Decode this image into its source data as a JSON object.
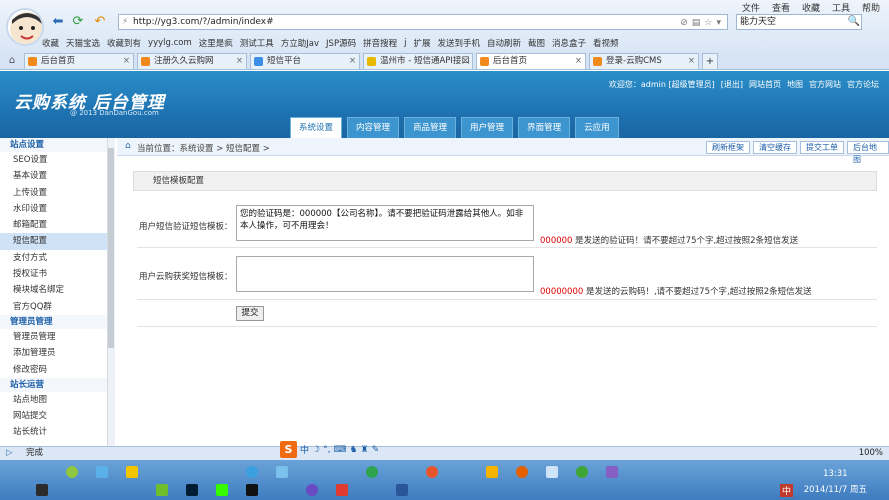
{
  "browser": {
    "menu": [
      "文件",
      "查看",
      "收藏",
      "工具",
      "帮助"
    ],
    "address": "http://yg3.com/?/admin/index#",
    "search_value": "能力天空",
    "bookmarks": [
      "收藏",
      "天猫宝选",
      "收藏到有",
      "yyylg.com",
      "这里是疯",
      "测试工具",
      "方立助Jav",
      "JSP源码",
      "拼音搜程",
      "j",
      "扩展",
      "发送到手机",
      "自动刷新",
      "截图",
      "消息盒子",
      "看视频"
    ],
    "tabs": [
      {
        "label": "后台首页",
        "active": false
      },
      {
        "label": "注册久久云购网",
        "active": false
      },
      {
        "label": "短信平台",
        "active": false
      },
      {
        "label": "温州市 - 短信通API接口",
        "active": false
      },
      {
        "label": "后台首页",
        "active": true
      },
      {
        "label": "登录-云购CMS",
        "active": false
      }
    ]
  },
  "header": {
    "logo": "云购系统 后台管理",
    "logo_sub": "@ 2013  DanDanGou.com",
    "welcome": "欢迎您：",
    "user": "admin",
    "role": "[超级管理员]",
    "logout": "[退出]",
    "site_home": "网站首页",
    "map": "地图",
    "official": "官方网站",
    "forum": "官方论坛"
  },
  "main_tabs": [
    {
      "label": "系统设置",
      "active": true
    },
    {
      "label": "内容管理",
      "active": false
    },
    {
      "label": "商品管理",
      "active": false
    },
    {
      "label": "用户管理",
      "active": false
    },
    {
      "label": "界面管理",
      "active": false
    },
    {
      "label": "云应用",
      "active": false
    }
  ],
  "sidebar": {
    "groups": [
      {
        "title": "站点设置",
        "items": [
          {
            "label": "SEO设置",
            "active": false
          },
          {
            "label": "基本设置",
            "active": false
          },
          {
            "label": "上传设置",
            "active": false
          },
          {
            "label": "水印设置",
            "active": false
          },
          {
            "label": "邮箱配置",
            "active": false
          },
          {
            "label": "短信配置",
            "active": true
          },
          {
            "label": "支付方式",
            "active": false
          },
          {
            "label": "授权证书",
            "active": false
          },
          {
            "label": "模块域名绑定",
            "active": false
          },
          {
            "label": "官方QQ群",
            "active": false
          }
        ]
      },
      {
        "title": "管理员管理",
        "items": [
          {
            "label": "管理员管理",
            "active": false
          },
          {
            "label": "添加管理员",
            "active": false
          },
          {
            "label": "修改密码",
            "active": false
          }
        ]
      },
      {
        "title": "站长运营",
        "items": [
          {
            "label": "站点地图",
            "active": false
          },
          {
            "label": "网站提交",
            "active": false
          },
          {
            "label": "站长统计",
            "active": false
          }
        ]
      }
    ]
  },
  "content": {
    "breadcrumb": "当前位置：系统设置 > 短信配置 >",
    "buttons": [
      "刷新框架",
      "清空缓存",
      "提交工单",
      "后台地图"
    ],
    "panel_title": "短信模板配置",
    "row1": {
      "label": "用户短信验证短信模板：",
      "value": "您的验证码是：000000【公司名称】。请不要把验证码泄露给其他人。如非本人操作，可不用理会！",
      "hint_code": "000000",
      "hint_text": " 是发送的验证码！请不要超过75个字,超过按照2条短信发送"
    },
    "row2": {
      "label": "用户云购获奖短信模板：",
      "value": "",
      "hint_code": "00000000",
      "hint_text": " 是发送的云购码！,请不要超过75个字,超过按照2条短信发送"
    },
    "submit": "提交"
  },
  "statusbar": {
    "status": "完成",
    "zoom": "100%"
  },
  "taskbar": {
    "time": "13:31",
    "date": "2014/11/7 周五",
    "ime_label": "S",
    "ime_mode": "中",
    "tray_lang": "中"
  }
}
